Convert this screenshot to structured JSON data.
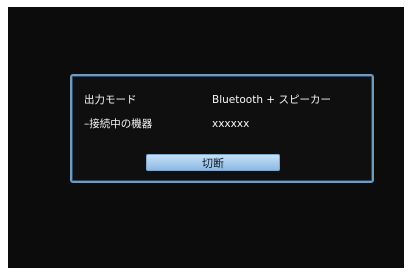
{
  "dialog": {
    "rows": [
      {
        "label": "出力モード",
        "value": "Bluetooth + スピーカー"
      },
      {
        "label": "–接続中の機器",
        "value": "xxxxxx"
      }
    ],
    "button_label": "切断"
  }
}
